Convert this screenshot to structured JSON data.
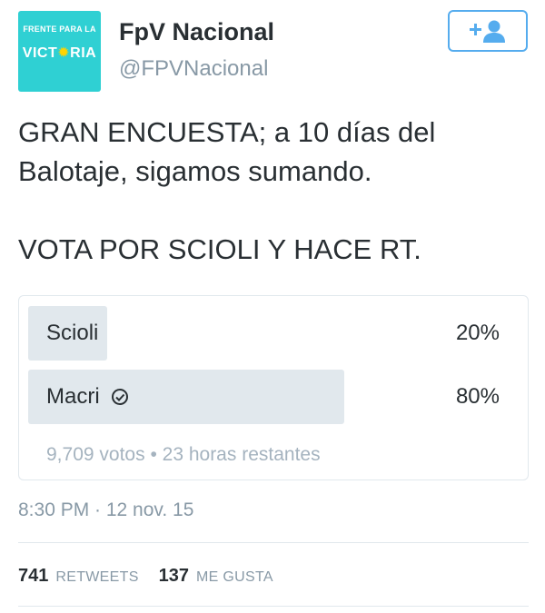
{
  "user": {
    "avatar_top": "FRENTE PARA LA",
    "avatar_mid_left": "VICT",
    "avatar_mid_sun": "✹",
    "avatar_mid_right": "RIA",
    "display_name": "FpV Nacional",
    "handle": "@FPVNacional",
    "follow_icon": "add-user-icon",
    "follow_color": "#55acee"
  },
  "tweet": {
    "text": "GRAN ENCUESTA; a 10 días del\nBalotaje, sigamos sumando.\n\nVOTA POR SCIOLI Y HACE RT."
  },
  "poll": {
    "choices": [
      {
        "label": "Scioli",
        "percent_text": "20%",
        "percent": 20,
        "winner": false
      },
      {
        "label": "Macri",
        "percent_text": "80%",
        "percent": 80,
        "winner": true
      }
    ],
    "votes": "9,709 votos",
    "separator": "•",
    "remaining": "23 horas restantes",
    "bar_color": "#e1e8ed"
  },
  "timestamp": "8:30 PM · 12 nov. 15",
  "stats": {
    "retweets_count": "741",
    "retweets_label": "RETWEETS",
    "likes_count": "137",
    "likes_label": "ME GUSTA"
  }
}
